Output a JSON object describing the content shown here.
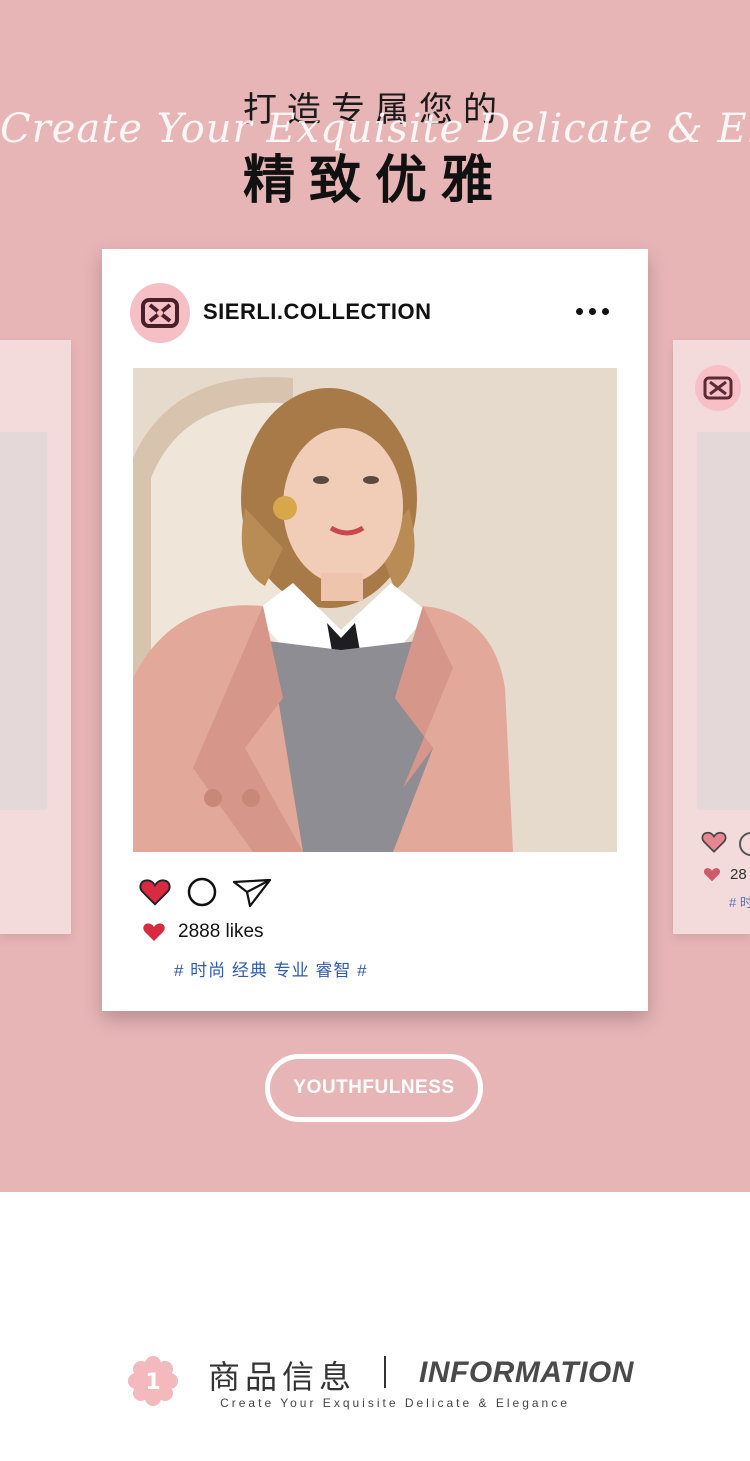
{
  "header": {
    "title_small": "打造专属您的",
    "script_en": "Create Your Exquisite Delicate & Elegance",
    "title_big": "精致优雅"
  },
  "post": {
    "username": "SIERLI.COLLECTION",
    "likes": "2888 likes",
    "tags": "# 时尚 经典 专业 睿智 #"
  },
  "side_card": {
    "likes_partial": "28",
    "tags_partial": "# 时"
  },
  "cta": {
    "label": "YOUTHFULNESS"
  },
  "info_section": {
    "badge_number": "1",
    "title_cn": "商品信息",
    "title_en": "INFORMATION",
    "subtitle": "Create Your Exquisite Delicate & Elegance"
  },
  "colors": {
    "background_pink": "#e8b5b7",
    "side_card_pink": "#f3dadb",
    "heart_red": "#d72a43",
    "tag_blue": "#2f5bb0",
    "badge_pink": "#f3b9bd"
  },
  "icons": [
    "more-icon",
    "heart-icon",
    "comment-icon",
    "share-icon",
    "logo-icon",
    "flower-badge-icon"
  ]
}
